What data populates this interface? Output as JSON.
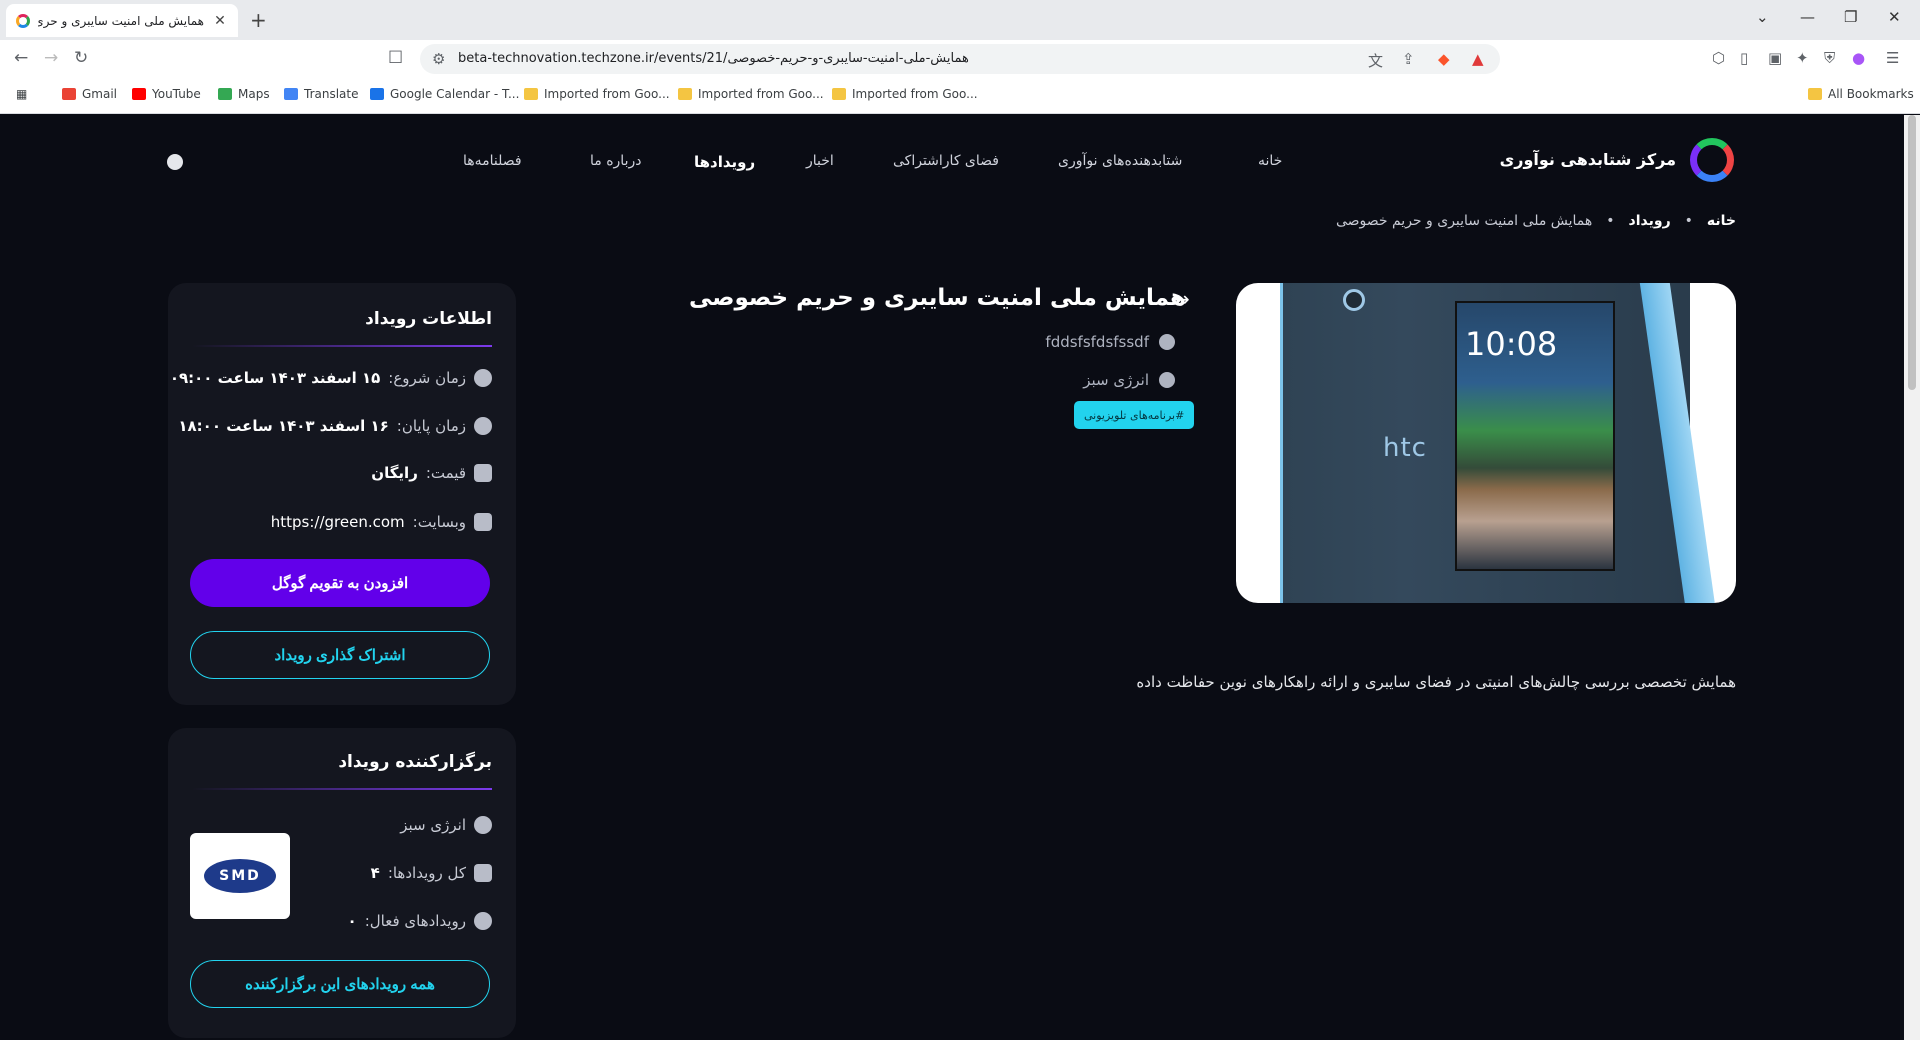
{
  "browser": {
    "tab_title": "همایش ملی امنیت سایبری و حری...",
    "url": "beta-technovation.techzone.ir/events/21/همایش-ملی-امنیت-سایبری-و-حریم-خصوصی",
    "bookmarks": [
      "Gmail",
      "YouTube",
      "Maps",
      "Translate",
      "Google Calendar - T...",
      "Imported from Goo...",
      "Imported from Goo...",
      "Imported from Goo...",
      "All Bookmarks"
    ]
  },
  "site": {
    "name": "مرکز شتابدهی نوآوری",
    "menu": [
      "خانه",
      "شتابدهنده‌های نوآوری",
      "فضای کاراشتراکی",
      "اخبار",
      "رویدادها",
      "درباره ما",
      "فصلنامه‌ها"
    ],
    "active_menu": "رویدادها"
  },
  "breadcrumb": [
    "خانه",
    "رویداد",
    "همایش ملی امنیت سایبری و حریم خصوصی"
  ],
  "event": {
    "title": "همایش ملی امنیت سایبری و حریم خصوصی",
    "location": "fddsfsfdsfssdf",
    "organizer": "انرژی سبز",
    "tag": "#برنامه‌های تلویزیونی",
    "description": "همایش تخصصی بررسی چالش‌های امنیتی در فضای سایبری و ارائه راهکارهای نوین حفاظت داده",
    "image_text": {
      "clock": "10:08",
      "brand": "htc"
    }
  },
  "info_card": {
    "title": "اطلاعات رویداد",
    "start_label": "زمان شروع:",
    "start_value": "۱۵ اسفند ۱۴۰۳ ساعت ۰۹:۰۰",
    "end_label": "زمان پایان:",
    "end_value": "۱۶ اسفند ۱۴۰۳ ساعت ۱۸:۰۰",
    "price_label": "قیمت:",
    "price_value": "رایگان",
    "website_label": "وبسایت:",
    "website_value": "https://green.com",
    "calendar_button": "افزودن به تقویم گوگل",
    "share_button": "اشتراک گذاری رویداد"
  },
  "organizer_card": {
    "title": "برگزارکننده رویداد",
    "name": "انرژی سبز",
    "total_label": "کل رویدادها:",
    "total_value": "۴",
    "active_label": "رویدادهای فعال:",
    "active_value": "۰",
    "logo_text": "SMD",
    "all_events_button": "همه رویدادهای این برگزارکننده"
  }
}
